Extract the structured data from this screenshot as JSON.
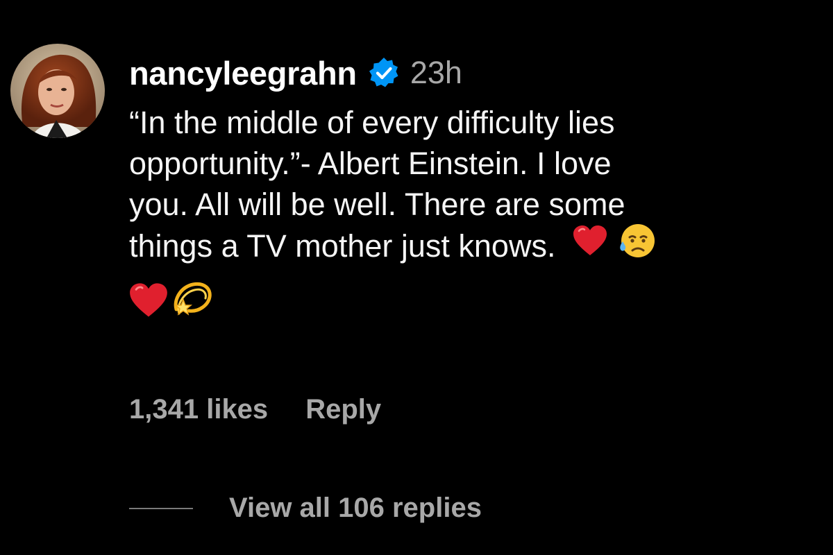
{
  "comment": {
    "username": "nancyleegrahn",
    "timestamp": "23h",
    "text_lines": [
      "“In the middle of every difficulty lies",
      "opportunity.”- Albert Einstein. I love",
      "you. All will be well. There are some",
      "things a TV mother just knows."
    ],
    "verified": true,
    "likes_label": "1,341 likes",
    "reply_label": "Reply",
    "view_replies_label": "View all 106 replies"
  },
  "icons": {
    "verified": "verified-badge-icon",
    "heart": "red-heart-emoji",
    "sad": "sad-but-relieved-face-emoji",
    "dizzy": "dizzy-emoji"
  },
  "colors": {
    "background": "#000000",
    "text": "#f5f5f5",
    "muted": "#a8a8a8",
    "verified_blue": "#0095f6",
    "heart_red": "#e0202e"
  }
}
